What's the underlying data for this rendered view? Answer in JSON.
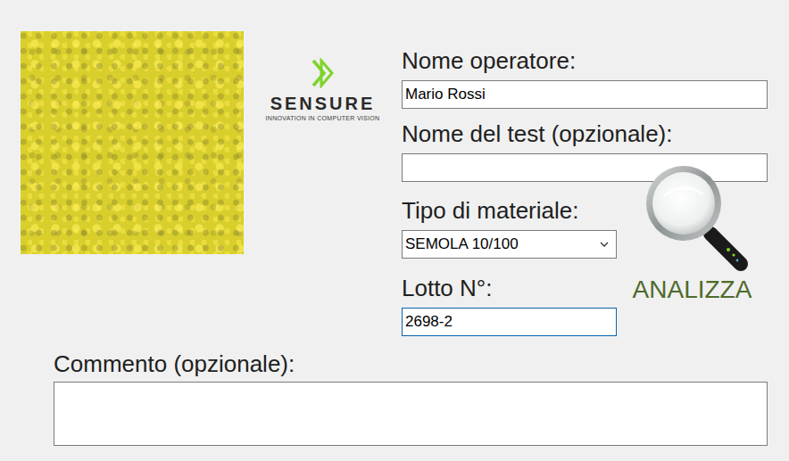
{
  "logo": {
    "name": "SENSURE",
    "tagline": "INNOVATION IN COMPUTER VISION"
  },
  "form": {
    "fields": [
      {
        "label": "Nome operatore:",
        "value": "Mario Rossi",
        "kind": "text",
        "focused": false
      },
      {
        "label": "Nome del test (opzionale):",
        "value": "",
        "kind": "text",
        "focused": false
      },
      {
        "label": "Tipo di materiale:",
        "value": "SEMOLA 10/100",
        "kind": "select",
        "focused": false
      },
      {
        "label": "Lotto N°:",
        "value": "2698-2",
        "kind": "text",
        "focused": true
      }
    ]
  },
  "analyze_button": {
    "label": "ANALIZZA"
  },
  "comment": {
    "label": "Commento (opzionale):",
    "value": ""
  }
}
